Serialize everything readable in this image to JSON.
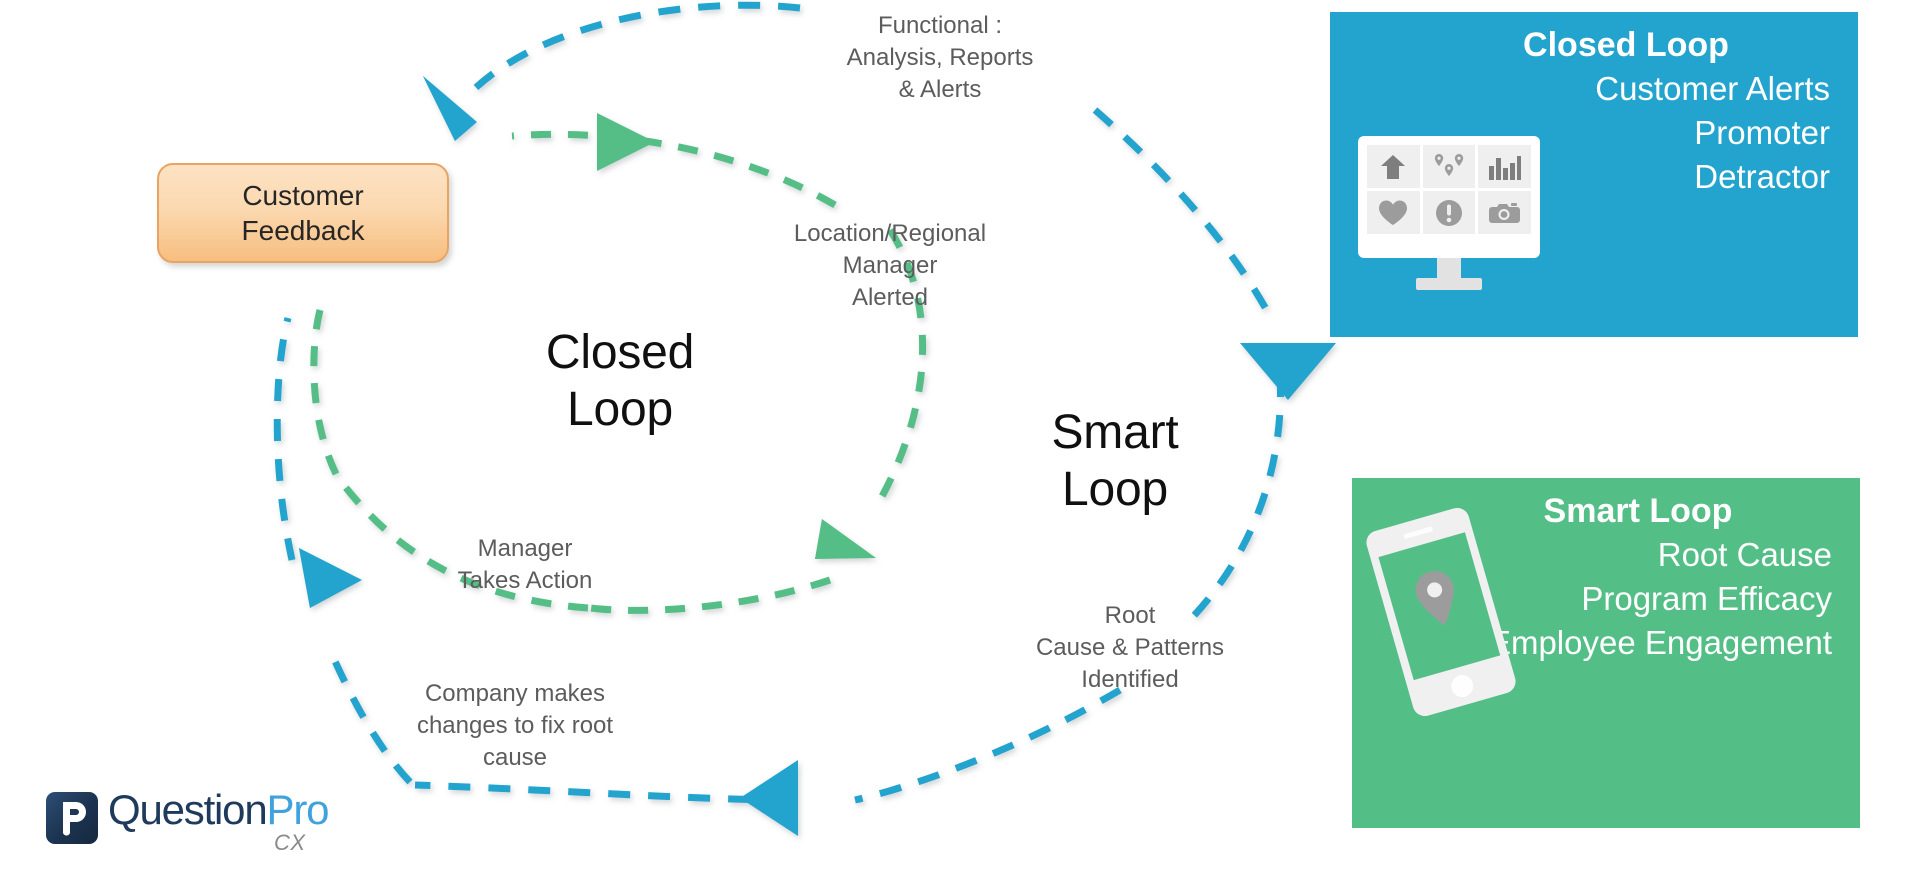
{
  "diagram": {
    "title": "Closed Loop and Smart Loop customer feedback cycle",
    "colors": {
      "closed_loop_blue": "#23A4CE",
      "smart_loop_green": "#54BE87",
      "feedback_orange": "#F7BE80",
      "feedback_border": "#E8A461",
      "label_gray": "#5C5C5C",
      "icon_gray": "#7E7E7E",
      "loop_title_black": "#101010"
    }
  },
  "feedback_box": {
    "text": "Customer\nFeedback"
  },
  "center_titles": {
    "closed_loop": "Closed\nLoop",
    "smart_loop": "Smart\nLoop"
  },
  "step_labels": {
    "functional": "Functional :\nAnalysis, Reports\n& Alerts",
    "location_manager": "Location/Regional\nManager\nAlerted",
    "root_cause": "Root\nCause & Patterns\nIdentified",
    "manager_action": "Manager\nTakes Action",
    "company_changes": "Company makes\nchanges to fix root\ncause"
  },
  "panels": {
    "closed_loop": {
      "heading": "Closed Loop",
      "lines": [
        "Customer Alerts",
        "Promoter",
        "Detractor"
      ],
      "icons": [
        "up-arrow-icon",
        "map-pins-icon",
        "bar-chart-icon",
        "heart-icon",
        "exclamation-circle-icon",
        "camera-icon"
      ]
    },
    "smart_loop": {
      "heading": "Smart Loop",
      "lines": [
        "Root Cause",
        "Program Efficacy",
        "Employee Engagement"
      ],
      "icons": [
        "mobile-phone-icon",
        "map-pin-icon"
      ]
    }
  },
  "logo": {
    "question": "Question",
    "pro": "Pro",
    "cx": "CX",
    "mark": "P"
  }
}
